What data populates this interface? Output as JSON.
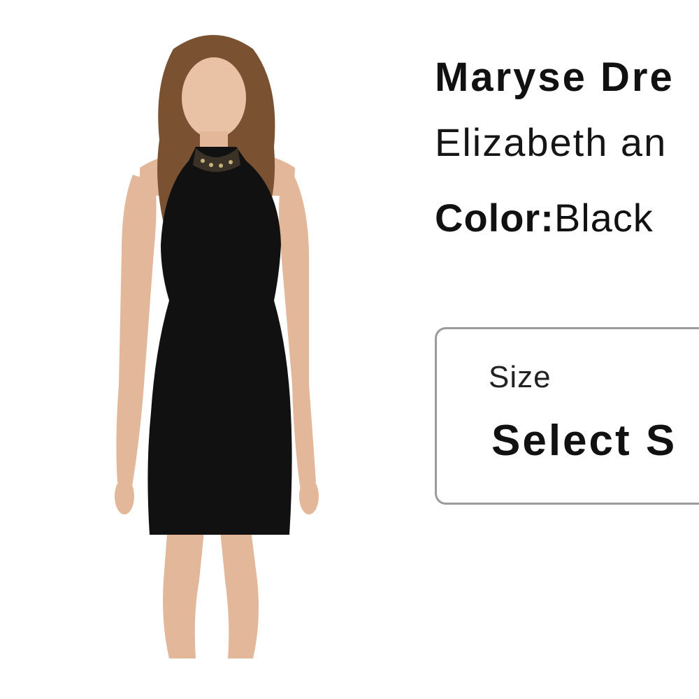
{
  "product": {
    "title": "Maryse Dre",
    "brand": "Elizabeth an",
    "color_label": "Color:",
    "color_value": "Black"
  },
  "size_select": {
    "label": "Size",
    "value": "Select S"
  },
  "colors": {
    "text": "#111111",
    "border": "#9a9a9a",
    "background": "#ffffff"
  }
}
